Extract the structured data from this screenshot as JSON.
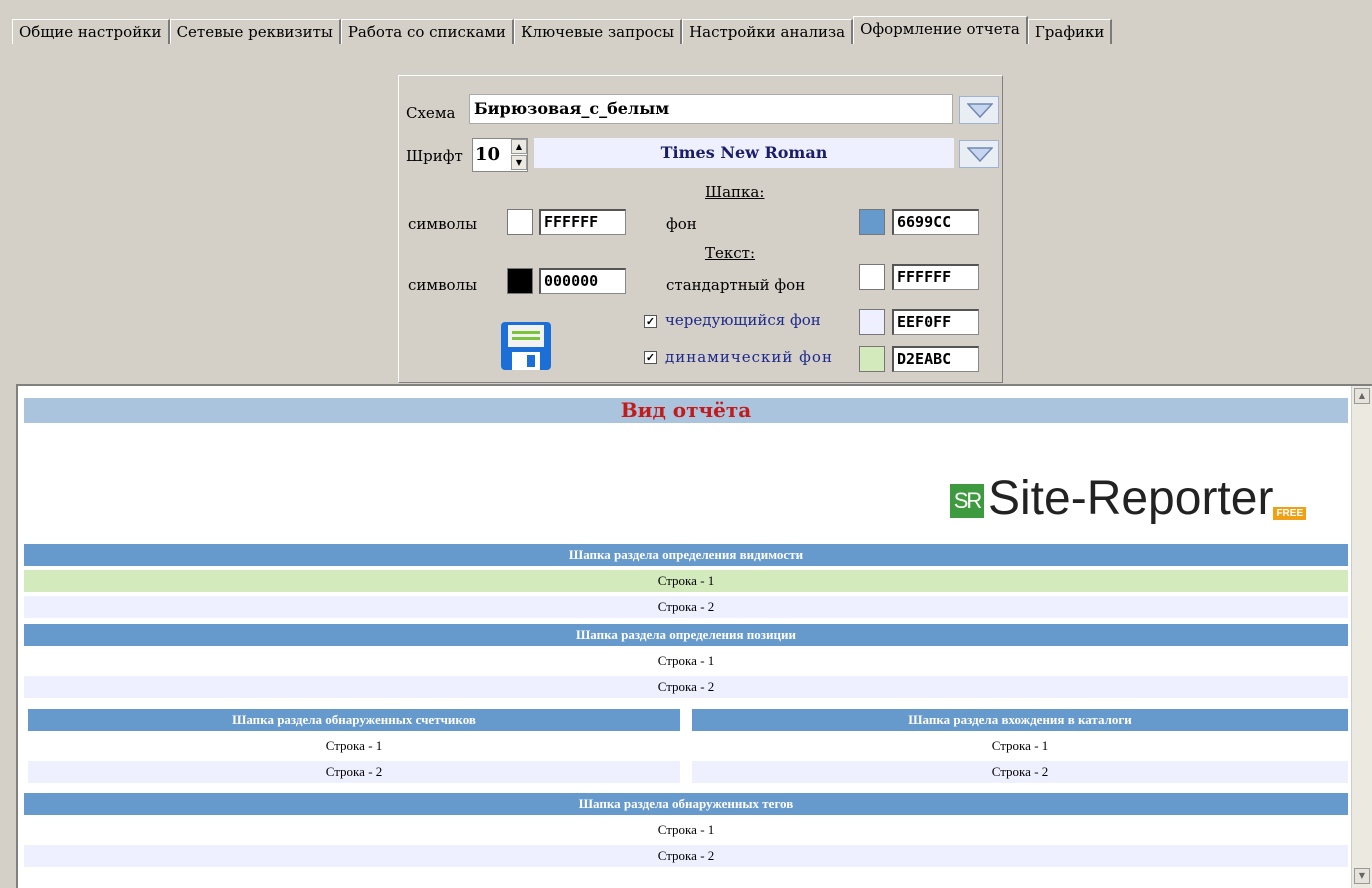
{
  "tabs": [
    "Общие настройки",
    "Сетевые реквизиты",
    "Работа со списками",
    "Ключевые запросы",
    "Настройки анализа",
    "Оформление отчета",
    "Графики"
  ],
  "active_tab": "Оформление отчета",
  "panel": {
    "scheme_label": "Схема",
    "scheme_value": "Бирюзовая_с_белым",
    "font_label": "Шрифт",
    "font_size": "10",
    "font_name": "Times New Roman",
    "header_section": "Шапка:",
    "symbols_label": "символы",
    "header_symbols_hex": "FFFFFF",
    "bg_label": "фон",
    "header_bg_hex": "6699CC",
    "text_section": "Текст:",
    "text_symbols_hex": "000000",
    "standard_bg_label": "стандартный фон",
    "standard_bg_hex": "FFFFFF",
    "alternating_bg_label": "чередующийся фон",
    "alternating_bg_hex": "EEF0FF",
    "dynamic_bg_label": "динамический фон",
    "dynamic_bg_hex": "D2EABC"
  },
  "colors": {
    "header_symbols": "#FFFFFF",
    "header_bg": "#6699CC",
    "text_symbols": "#000000",
    "standard_bg": "#FFFFFF",
    "alternating_bg": "#EEF0FF",
    "dynamic_bg": "#D2EABC"
  },
  "preview": {
    "title": "Вид отчёта",
    "logo_text": "Site-Reporter",
    "logo_mark": "SR",
    "logo_badge": "FREE",
    "visibility_header": "Шапка раздела определения видимости",
    "position_header": "Шапка раздела определения позиции",
    "counters_header": "Шапка раздела обнаруженных счетчиков",
    "catalogs_header": "Шапка раздела вхождения в каталоги",
    "tags_header": "Шапка раздела обнаруженных тегов",
    "row1": "Строка - 1",
    "row2": "Строка - 2"
  }
}
